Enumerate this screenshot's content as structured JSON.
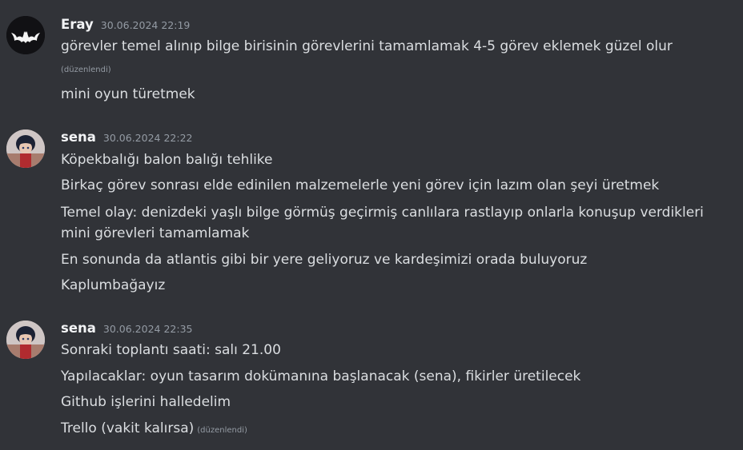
{
  "messages": [
    {
      "author": "Eray",
      "timestamp": "30.06.2024 22:19",
      "avatar_icon": "batman-logo-icon",
      "lines": [
        "görevler temel alınıp bilge birisinin görevlerini tamamlamak 4-5 görev eklemek güzel olur",
        "mini oyun türetmek"
      ],
      "edited_label": "(düzenlendi)"
    },
    {
      "author": "sena",
      "timestamp": "30.06.2024 22:22",
      "avatar_icon": "character-portrait-icon",
      "lines": [
        "Köpekbalığı balon balığı tehlike",
        "Birkaç görev sonrası elde edinilen malzemelerle yeni görev için lazım olan şeyi üretmek",
        "Temel olay: denizdeki yaşlı bilge görmüş geçirmiş canlılara rastlayıp onlarla konuşup verdikleri",
        "mini görevleri tamamlamak",
        "En sonunda da atlantis gibi bir yere geliyoruz ve kardeşimizi orada buluyoruz",
        "Kaplumbağayız"
      ]
    },
    {
      "author": "sena",
      "timestamp": "30.06.2024 22:35",
      "avatar_icon": "character-portrait-icon",
      "lines": [
        "Sonraki toplantı saati: salı 21.00",
        "Yapılacaklar: oyun tasarım dokümanına başlanacak (sena), fikirler üretilecek",
        "Github işlerini halledelim",
        "Trello (vakit kalırsa)"
      ],
      "edited_label": "(düzenlendi)"
    }
  ]
}
